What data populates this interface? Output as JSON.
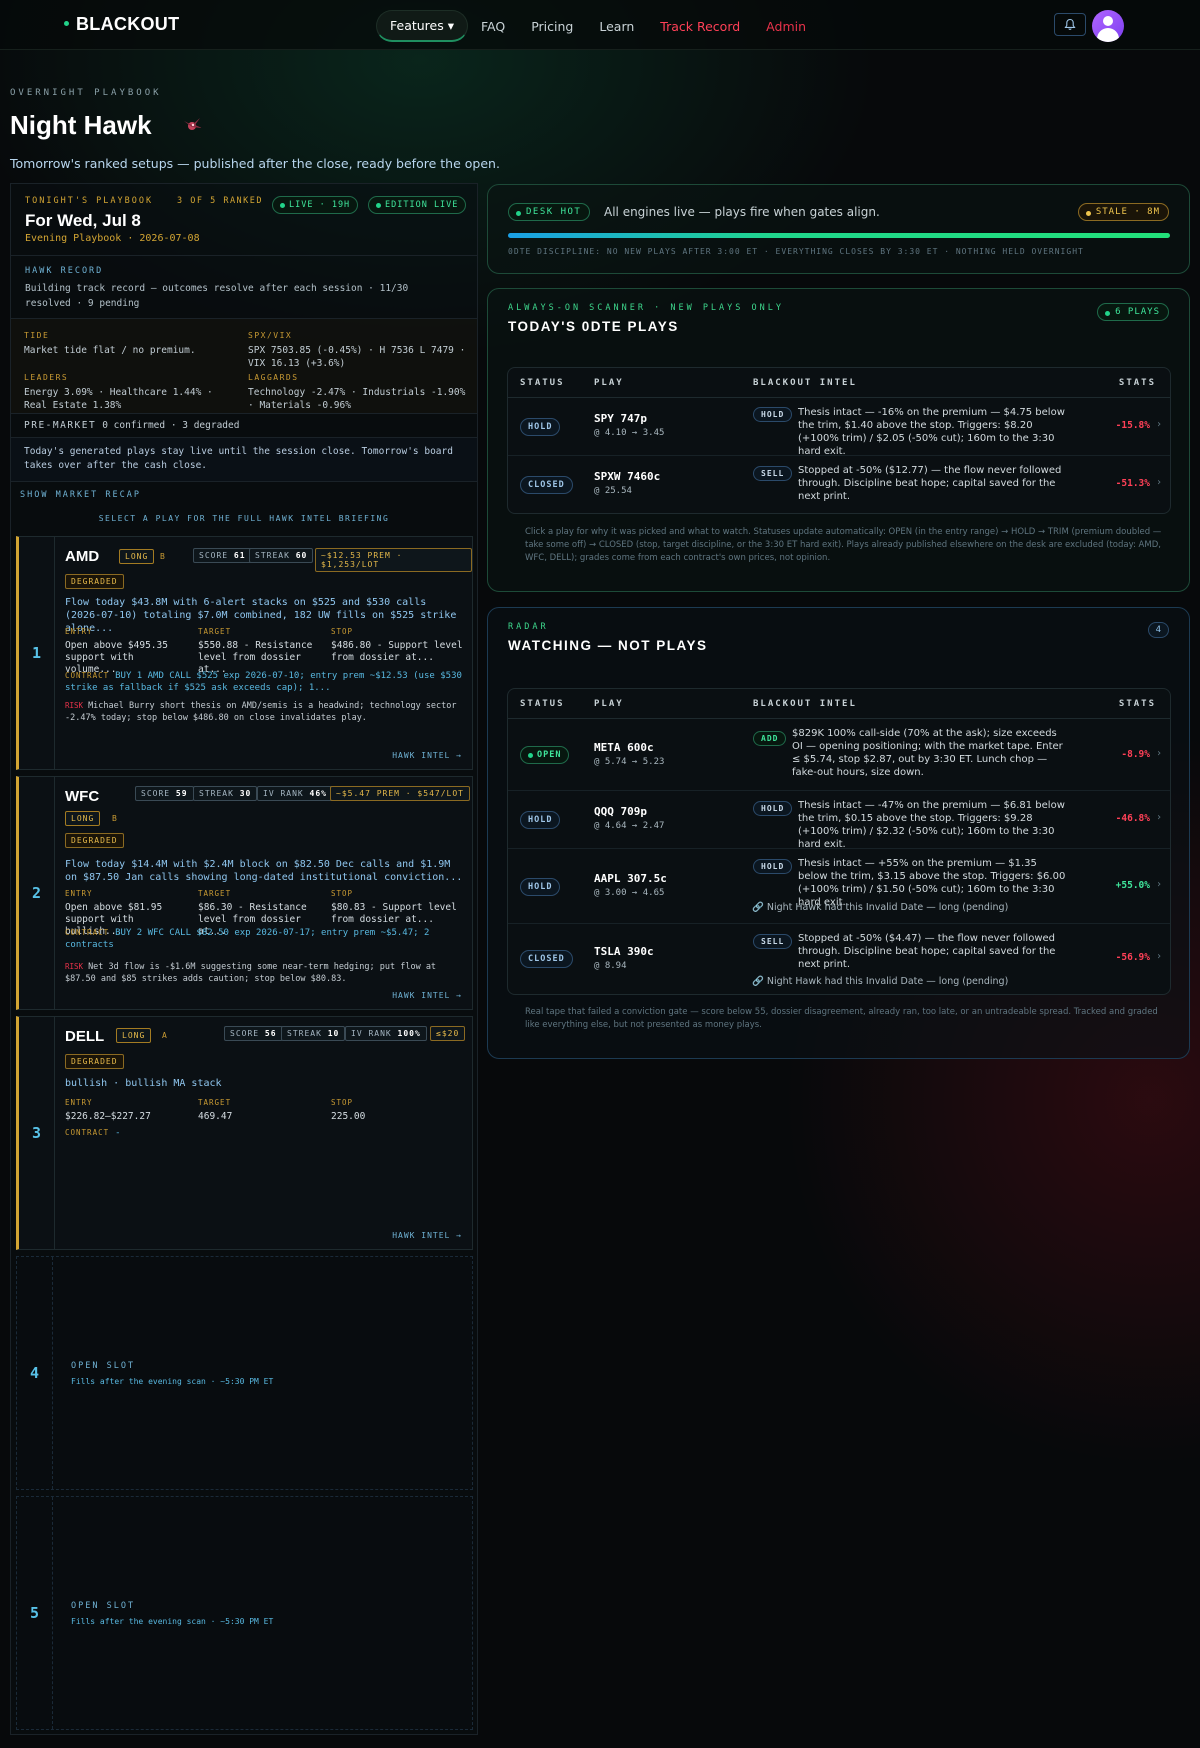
{
  "nav": {
    "logo": "BLACKOUT",
    "links": [
      "Features ▾",
      "FAQ",
      "Pricing",
      "Learn",
      "Track Record",
      "Admin"
    ]
  },
  "page": {
    "kicker": "OVERNIGHT PLAYBOOK",
    "title": "Night Hawk",
    "subtitle": "Tomorrow's ranked setups — published after the close, ready before the open."
  },
  "playbook": {
    "kicker": "TONIGHT'S PLAYBOOK",
    "ranked": "3 OF 5 RANKED",
    "live_badge": "LIVE · 19H",
    "edition_badge": "EDITION LIVE",
    "title": "For Wed, Jul 8",
    "subtitle": "Evening Playbook · 2026-07-08",
    "record_label": "HAWK RECORD",
    "record_text": "Building track record — outcomes resolve after each session · 11/30 resolved · 9 pending",
    "tide_label": "TIDE",
    "tide": "Market tide flat / no premium.",
    "spx_label": "SPX/VIX",
    "spx": "SPX 7503.85 (-0.45%) · H 7536 L 7479 · VIX 16.13 (+3.6%)",
    "leaders_label": "LEADERS",
    "leaders": "Energy 3.09% · Healthcare 1.44% · Real Estate 1.38%",
    "laggards_label": "LAGGARDS",
    "laggards": "Technology -2.47% · Industrials -1.90% · Materials -0.96%",
    "premarket_label": "PRE-MARKET",
    "premarket": "0 confirmed · 3 degraded",
    "note": "Today's generated plays stay live until the session close. Tomorrow's board takes over after the cash close.",
    "recap": "SHOW MARKET RECAP",
    "select": "SELECT A PLAY FOR THE FULL HAWK INTEL BRIEFING"
  },
  "plays": [
    {
      "rank": "1",
      "ticker": "AMD",
      "dir": "LONG",
      "grade": "B",
      "degraded": "DEGRADED",
      "score_label": "SCORE",
      "score": "61",
      "streak_label": "STREAK",
      "streak": "60",
      "prem": "~$12.53 PREM · $1,253/LOT",
      "flow": "Flow today $43.8M with 6-alert stacks on $525 and $530 calls (2026-07-10) totaling $7.0M combined, 182 UW fills on $525 strike alone...",
      "entry_label": "ENTRY",
      "entry": "Open above $495.35 support with volume...",
      "target_label": "TARGET",
      "target": "$550.88 - Resistance level from dossier at...",
      "stop_label": "STOP",
      "stop": "$486.80 - Support level from dossier at...",
      "contract_label": "CONTRACT",
      "contract": "BUY 1 AMD CALL $525 exp 2026-07-10; entry prem ~$12.53 (use $530 strike as fallback if $525 ask exceeds cap); 1...",
      "risk_label": "RISK",
      "risk": "Michael Burry short thesis on AMD/semis is a headwind; technology sector -2.47% today; stop below $486.80 on close invalidates play.",
      "intel": "HAWK INTEL →"
    },
    {
      "rank": "2",
      "ticker": "WFC",
      "dir": "LONG",
      "grade": "B",
      "degraded": "DEGRADED",
      "score_label": "SCORE",
      "score": "59",
      "streak_label": "STREAK",
      "streak": "30",
      "iv_label": "IV RANK",
      "iv": "46%",
      "prem": "~$5.47 PREM · $547/LOT",
      "flow": "Flow today $14.4M with $2.4M block on $82.50 Dec calls and $1.9M on $87.50 Jan calls showing long-dated institutional conviction...",
      "entry_label": "ENTRY",
      "entry": "Open above $81.95 support with bullish...",
      "target_label": "TARGET",
      "target": "$86.30 - Resistance level from dossier at...",
      "stop_label": "STOP",
      "stop": "$80.83 - Support level from dossier at...",
      "contract_label": "CONTRACT",
      "contract": "BUY 2 WFC CALL $82.50 exp 2026-07-17; entry prem ~$5.47; 2 contracts",
      "risk_label": "RISK",
      "risk": "Net 3d flow is -$1.6M suggesting some near-term hedging; put flow at $87.50 and $85 strikes adds caution; stop below $80.83.",
      "intel": "HAWK INTEL →"
    },
    {
      "rank": "3",
      "ticker": "DELL",
      "dir": "LONG",
      "grade": "A",
      "degraded": "DEGRADED",
      "score_label": "SCORE",
      "score": "56",
      "streak_label": "STREAK",
      "streak": "10",
      "iv_label": "IV RANK",
      "iv": "100%",
      "prem": "≤$20",
      "flow": "bullish · bullish MA stack",
      "entry_label": "ENTRY",
      "entry": "$226.82–$227.27",
      "target_label": "TARGET",
      "target": "469.47",
      "stop_label": "STOP",
      "stop": "225.00",
      "contract_label": "CONTRACT",
      "contract": "-",
      "intel": "HAWK INTEL →"
    }
  ],
  "slots": [
    {
      "rank": "4",
      "title": "OPEN SLOT",
      "sub": "Fills after the evening scan · ~5:30 PM ET"
    },
    {
      "rank": "5",
      "title": "OPEN SLOT",
      "sub": "Fills after the evening scan · ~5:30 PM ET"
    }
  ],
  "desk": {
    "badge": "DESK HOT",
    "text": "All engines live — plays fire when gates align.",
    "stale": "STALE · 8M",
    "discipline": "0DTE DISCIPLINE: NO NEW PLAYS AFTER 3:00 ET · EVERYTHING CLOSES BY 3:30 ET · NOTHING HELD OVERNIGHT"
  },
  "zero": {
    "kicker": "ALWAYS-ON SCANNER · NEW PLAYS ONLY",
    "title": "TODAY'S 0DTE PLAYS",
    "count": "6 PLAYS",
    "headers": [
      "STATUS",
      "PLAY",
      "BLACKOUT INTEL",
      "STATS"
    ],
    "rows": [
      {
        "status": "HOLD",
        "play": "SPY 747p",
        "price": "@ 4.10 → 3.45",
        "intel_pill": "HOLD",
        "intel": "Thesis intact — -16% on the premium — $4.75 below the trim, $1.40 above the stop. Triggers: $8.20 (+100% trim) / $2.05 (-50% cut); 160m to the 3:30 hard exit.",
        "pct": "-15.8%"
      },
      {
        "status": "CLOSED",
        "play": "SPXW 7460c",
        "price": "@ 25.54",
        "intel_pill": "SELL",
        "intel": "Stopped at -50% ($12.77) — the flow never followed through. Discipline beat hope; capital saved for the next print.",
        "pct": "-51.3%"
      }
    ],
    "footnote": "Click a play for why it was picked and what to watch. Statuses update automatically: OPEN (in the entry range) → HOLD → TRIM (premium doubled — take some off) → CLOSED (stop, target discipline, or the 3:30 ET hard exit). Plays already published elsewhere on the desk are excluded (today: AMD, WFC, DELL); grades come from each contract's own prices, not opinion."
  },
  "radar": {
    "kicker": "RADAR",
    "title": "WATCHING — NOT PLAYS",
    "count": "4",
    "headers": [
      "STATUS",
      "PLAY",
      "BLACKOUT INTEL",
      "STATS"
    ],
    "rows": [
      {
        "status": "OPEN",
        "play": "META 600c",
        "price": "@ 5.74 → 5.23",
        "intel_pill": "ADD",
        "intel": "$829K 100% call-side (70% at the ask); size exceeds OI — opening positioning; with the market tape. Enter ≤ $5.74, stop $2.87, out by 3:30 ET. Lunch chop — fake-out hours, size down.",
        "pct": "-8.9%",
        "invalid": ""
      },
      {
        "status": "HOLD",
        "play": "QQQ 709p",
        "price": "@ 4.64 → 2.47",
        "intel_pill": "HOLD",
        "intel": "Thesis intact — -47% on the premium — $6.81 below the trim, $0.15 above the stop. Triggers: $9.28 (+100% trim) / $2.32 (-50% cut); 160m to the 3:30 hard exit.",
        "pct": "-46.8%",
        "invalid": ""
      },
      {
        "status": "HOLD",
        "play": "AAPL 307.5c",
        "price": "@ 3.00 → 4.65",
        "intel_pill": "HOLD",
        "intel": "Thesis intact — +55% on the premium — $1.35 below the trim, $3.15 above the stop. Triggers: $6.00 (+100% trim) / $1.50 (-50% cut); 160m to the 3:30 hard exit.",
        "pct": "+55.0%",
        "invalid": "Night Hawk had this Invalid Date — long (pending)"
      },
      {
        "status": "CLOSED",
        "play": "TSLA 390c",
        "price": "@ 8.94",
        "intel_pill": "SELL",
        "intel": "Stopped at -50% ($4.47) — the flow never followed through. Discipline beat hope; capital saved for the next print.",
        "pct": "-56.9%",
        "invalid": "Night Hawk had this Invalid Date — long (pending)"
      }
    ],
    "footnote": "Real tape that failed a conviction gate — score below 55, dossier disagreement, already ran, too late, or an untradeable spread. Tracked and graded like everything else, but not presented as money plays."
  }
}
